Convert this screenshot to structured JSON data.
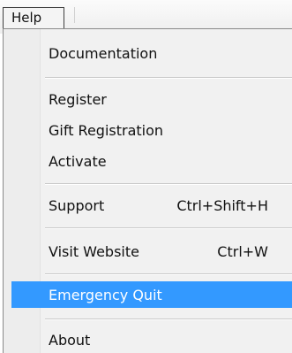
{
  "menubar": {
    "help_label": "Help"
  },
  "menu": {
    "items": [
      {
        "label": "Documentation",
        "shortcut": ""
      },
      {
        "label": "Register",
        "shortcut": ""
      },
      {
        "label": "Gift Registration",
        "shortcut": ""
      },
      {
        "label": "Activate",
        "shortcut": ""
      },
      {
        "label": "Support",
        "shortcut": "Ctrl+Shift+H"
      },
      {
        "label": "Visit Website",
        "shortcut": "Ctrl+W"
      },
      {
        "label": "Emergency Quit",
        "shortcut": ""
      },
      {
        "label": "About",
        "shortcut": ""
      }
    ],
    "highlighted_item": "Emergency Quit",
    "highlight_color": "#3399ff"
  }
}
